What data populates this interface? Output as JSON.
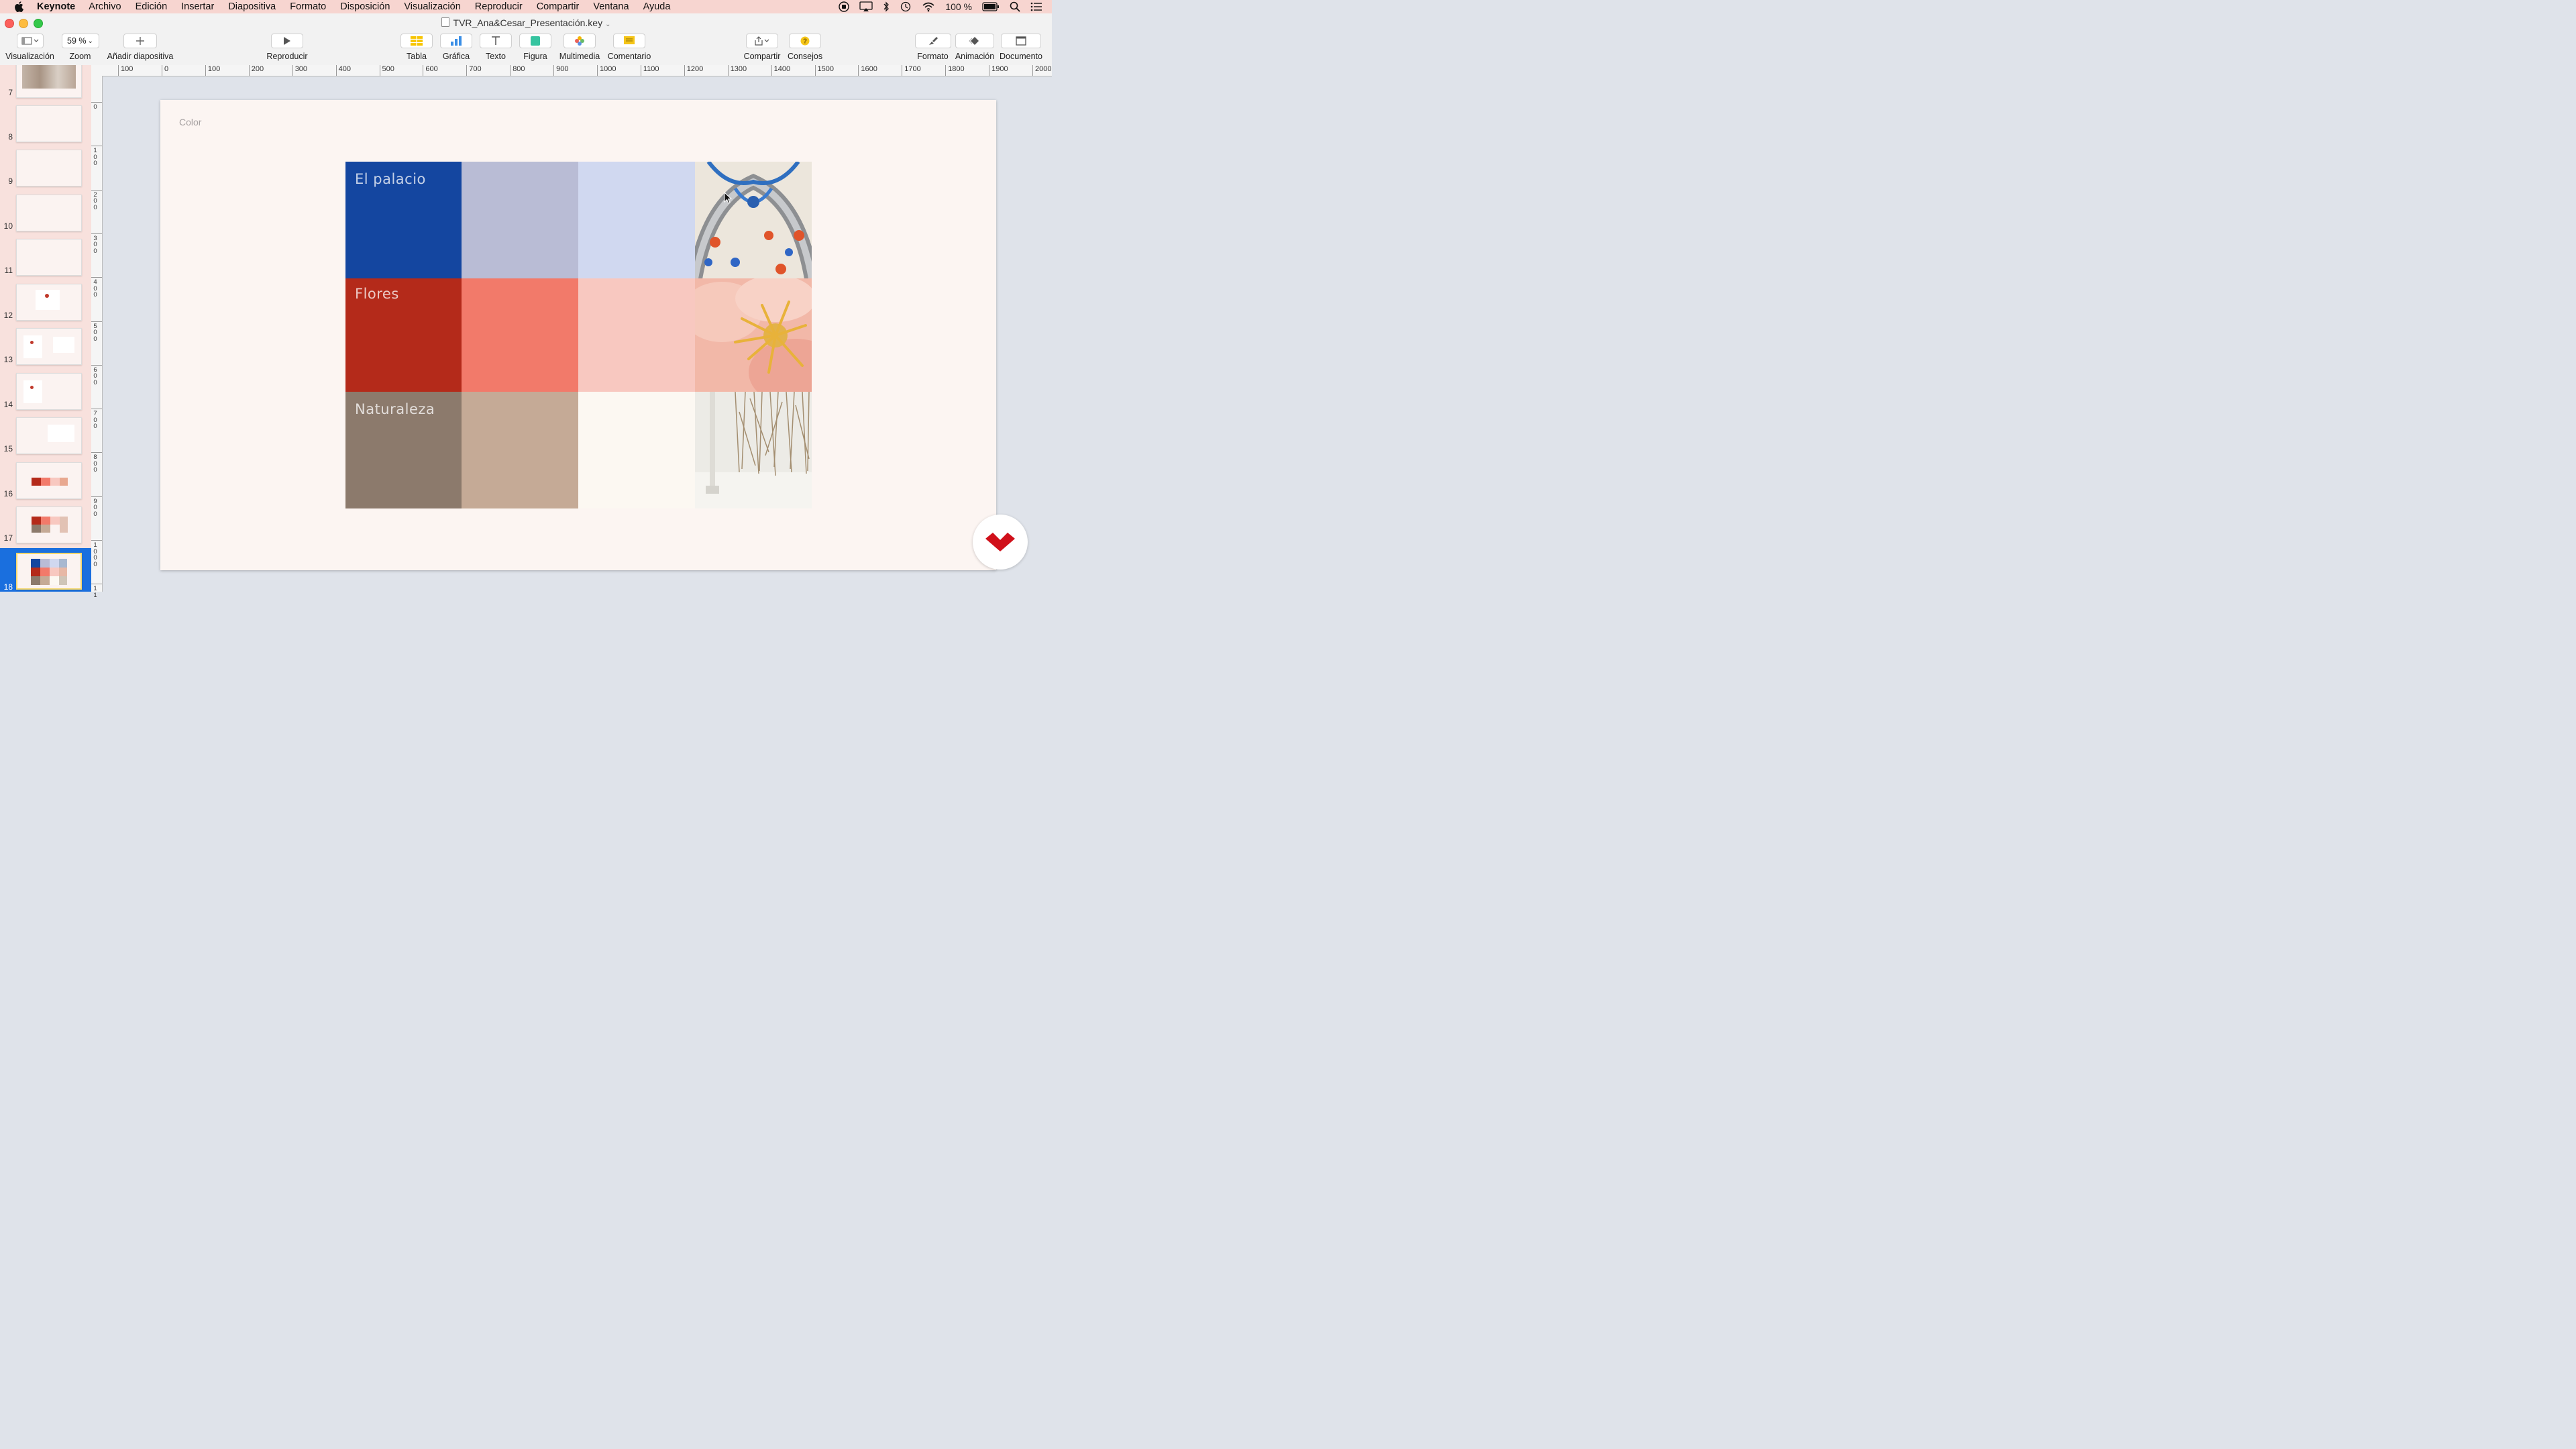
{
  "menubar": {
    "app": "Keynote",
    "items": [
      "Archivo",
      "Edición",
      "Insertar",
      "Diapositiva",
      "Formato",
      "Disposición",
      "Visualización",
      "Reproducir",
      "Compartir",
      "Ventana",
      "Ayuda"
    ],
    "battery": "100 %"
  },
  "window": {
    "title": "TVR_Ana&Cesar_Presentación.key"
  },
  "toolbar": {
    "view": "Visualización",
    "zoom_value": "59 %",
    "zoom": "Zoom",
    "add_slide": "Añadir diapositiva",
    "play": "Reproducir",
    "table": "Tabla",
    "chart": "Gráfica",
    "text": "Texto",
    "shape": "Figura",
    "media": "Multimedia",
    "comment": "Comentario",
    "share": "Compartir",
    "tips": "Consejos",
    "format": "Formato",
    "animate": "Animación",
    "document": "Documento"
  },
  "ruler": {
    "h_labels": [
      "100",
      "0",
      "100",
      "200",
      "300",
      "400",
      "500",
      "600",
      "700",
      "800",
      "900",
      "1000",
      "1100",
      "1200",
      "1300",
      "1400",
      "1500",
      "1600",
      "1700",
      "1800",
      "1900",
      "2000"
    ],
    "v_labels": [
      "0",
      "100",
      "200",
      "300",
      "400",
      "500",
      "600",
      "700",
      "800",
      "900",
      "1000",
      "11"
    ]
  },
  "navigator": {
    "slides": [
      {
        "num": "7"
      },
      {
        "num": "8"
      },
      {
        "num": "9"
      },
      {
        "num": "10"
      },
      {
        "num": "11"
      },
      {
        "num": "12"
      },
      {
        "num": "13"
      },
      {
        "num": "14"
      },
      {
        "num": "15"
      },
      {
        "num": "16"
      },
      {
        "num": "17"
      },
      {
        "num": "18",
        "selected": true
      }
    ]
  },
  "slide": {
    "title": "Color",
    "rows": [
      {
        "label": "El palacio",
        "colors": [
          "#1446a0",
          "#b9bcd5",
          "#d0d8f0"
        ],
        "image": "tiles-image"
      },
      {
        "label": "Flores",
        "colors": [
          "#b42a1a",
          "#f27a6a",
          "#f8c8c0"
        ],
        "image": "flower-image"
      },
      {
        "label": "Naturaleza",
        "colors": [
          "#8c7a6c",
          "#c5aa96",
          "#fcf8f2"
        ],
        "image": "nature-image"
      }
    ]
  }
}
